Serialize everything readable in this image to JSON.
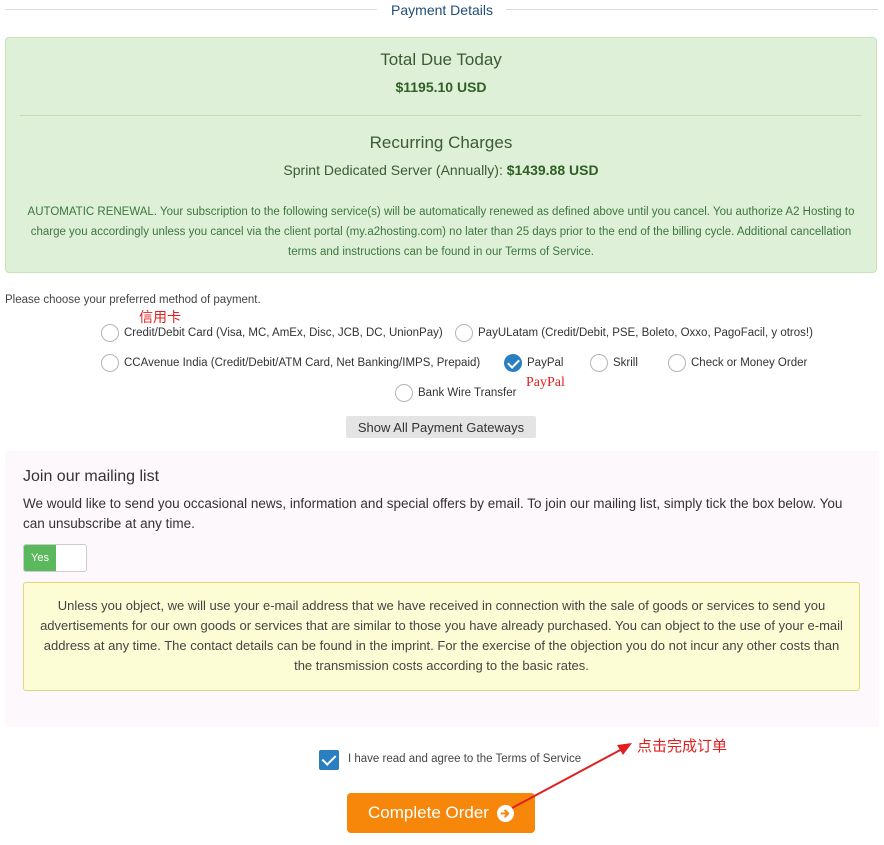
{
  "section": {
    "title": "Payment Details"
  },
  "summary": {
    "total_label": "Total Due Today",
    "total_amount": "$1195.10 USD",
    "recurring_label": "Recurring Charges",
    "recurring_item": "Sprint Dedicated Server (Annually): ",
    "recurring_amount": "$1439.88 USD",
    "renewal_text": "AUTOMATIC RENEWAL. Your subscription to the following service(s) will be automatically renewed as defined above until you cancel. You authorize A2 Hosting to charge you accordingly unless you cancel via the client portal (my.a2hosting.com) no later than 25 days prior to the end of the billing cycle. Additional cancellation terms and instructions can be found in our Terms of Service."
  },
  "payment": {
    "prompt": "Please choose your preferred method of payment.",
    "methods": [
      {
        "label": "Credit/Debit Card (Visa, MC, AmEx, Disc, JCB, DC, UnionPay)",
        "checked": false
      },
      {
        "label": "PayULatam (Credit/Debit, PSE, Boleto, Oxxo, PagoFacil, y otros!)",
        "checked": false
      },
      {
        "label": "CCAvenue India (Credit/Debit/ATM Card, Net Banking/IMPS, Prepaid)",
        "checked": false
      },
      {
        "label": "PayPal",
        "checked": true
      },
      {
        "label": "Skrill",
        "checked": false
      },
      {
        "label": "Check or Money Order",
        "checked": false
      },
      {
        "label": "Bank Wire Transfer",
        "checked": false
      }
    ],
    "show_all_label": "Show All Payment Gateways"
  },
  "annotations": {
    "credit_card": "信用卡",
    "paypal": "PayPal",
    "complete_order": "点击完成订单",
    "color": "#e02020"
  },
  "mailing": {
    "title": "Join our mailing list",
    "description": "We would like to send you occasional news, information and special offers by email. To join our mailing list, simply tick the box below. You can unsubscribe at any time.",
    "toggle_label": "Yes",
    "toggle_on": true,
    "notice": "Unless you object, we will use your e-mail address that we have received in connection with the sale of goods or services to send you advertisements for our own goods or services that are similar to those you have already purchased. You can object to the use of your e-mail address at any time. The contact details can be found in the imprint. For the exercise of the objection you do not incur any other costs than the transmission costs according to the basic rates."
  },
  "terms": {
    "label": "I have read and agree to the Terms of Service",
    "checked": true
  },
  "order": {
    "complete_label": "Complete Order",
    "button_color": "#f7870a"
  }
}
